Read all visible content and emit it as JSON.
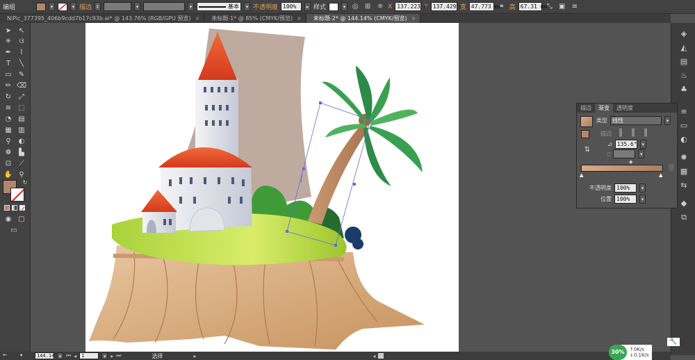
{
  "control_bar": {
    "group_label": "编组",
    "stroke_label": "描边",
    "stroke_style": "基本",
    "opacity_label": "不透明度",
    "opacity_value": "100%",
    "style_label": "样式",
    "x_label": "X",
    "x_value": "137.223 m",
    "y_label": "Y",
    "y_value": "137.429 m",
    "w_label": "宽",
    "w_value": "47.773 mm",
    "h_label": "高",
    "h_value": "67.31 mm",
    "fill_color": "#b5876a",
    "accent_color": "#e0a05a"
  },
  "tabs": [
    {
      "label": "NiPic_377395_406b9cdd7b17c93b.ai* @ 143.76% (RGB/GPU 预览)",
      "active": false
    },
    {
      "label": "未标题-1* @ 85% (CMYK/预览)",
      "active": false
    },
    {
      "label": "未标题-2* @ 144.14% (CMYK/预览)",
      "active": true
    }
  ],
  "gradient_panel": {
    "tabs": [
      "描边",
      "渐变",
      "透明度"
    ],
    "active_tab": "渐变",
    "type_label": "类型",
    "type_value": "线性",
    "stroke_label": "描边",
    "angle_value": "135.6°",
    "opacity_label": "不透明度",
    "opacity_value": "100%",
    "location_label": "位置",
    "location_value": "100%",
    "gradient_start": "#d9ab88",
    "gradient_end": "#a97d62"
  },
  "status_bar": {
    "zoom": "144.14",
    "page": "1",
    "tool": "选择"
  },
  "network_badge": {
    "percent": "30%",
    "up": "0K/s",
    "down": "0.1K/s"
  }
}
